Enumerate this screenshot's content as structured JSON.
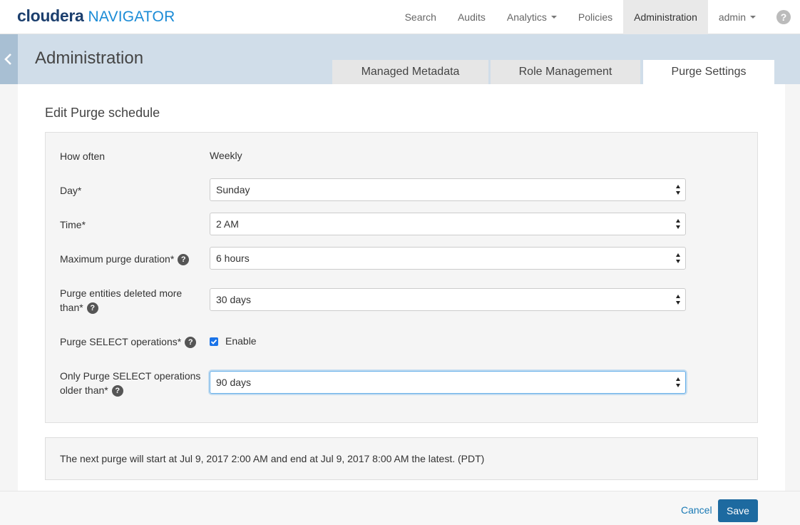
{
  "brand": {
    "name_bold": "cloudera",
    "name_light": "NAVIGATOR"
  },
  "nav": {
    "items": [
      {
        "label": "Search"
      },
      {
        "label": "Audits"
      },
      {
        "label": "Analytics"
      },
      {
        "label": "Policies"
      },
      {
        "label": "Administration"
      },
      {
        "label": "admin"
      }
    ],
    "help_glyph": "?"
  },
  "header": {
    "title": "Administration",
    "tabs": [
      {
        "label": "Managed Metadata"
      },
      {
        "label": "Role Management"
      },
      {
        "label": "Purge Settings"
      }
    ]
  },
  "form": {
    "section_title": "Edit Purge schedule",
    "how_often_label": "How often",
    "how_often_value": "Weekly",
    "day_label": "Day*",
    "day_value": "Sunday",
    "time_label": "Time*",
    "time_value": "2 AM",
    "max_duration_label": "Maximum purge duration*",
    "max_duration_value": "6 hours",
    "purge_entities_label": "Purge entities deleted more than*",
    "purge_entities_value": "30 days",
    "purge_select_label": "Purge SELECT operations*",
    "purge_select_checkbox_label": "Enable",
    "purge_select_enabled": true,
    "only_select_label": "Only Purge SELECT operations older than*",
    "only_select_value": "90 days"
  },
  "note": {
    "text": "The next purge will start at Jul 9, 2017 2:00 AM and end at Jul 9, 2017 8:00 AM the latest. (PDT)"
  },
  "footer": {
    "cancel_label": "Cancel",
    "save_label": "Save"
  },
  "icons": {
    "collapse": "chevron-left-icon",
    "help": "question-circle-icon",
    "check": "check-icon"
  },
  "colors": {
    "brand_dark": "#1c3f6e",
    "brand_accent": "#1a8bd6",
    "header_band": "#d0dde9",
    "primary_button": "#1d6aa0",
    "link": "#1a7ab5"
  }
}
